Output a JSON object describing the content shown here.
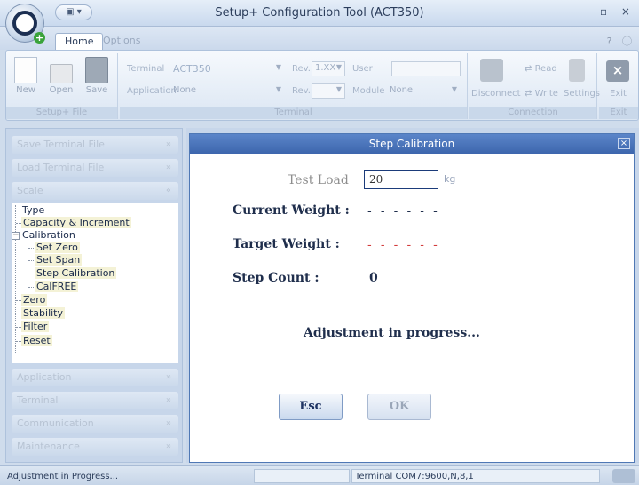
{
  "window": {
    "title": "Setup+ Configuration Tool (ACT350)",
    "qat_label": "▾",
    "controls": "– ▫ ×"
  },
  "tabs": [
    {
      "label": "Home"
    },
    {
      "label": "Options"
    }
  ],
  "help_icons": "? ⓘ",
  "ribbon": {
    "file_group": {
      "label": "Setup+ File",
      "new": "New",
      "open": "Open",
      "save": "Save"
    },
    "terminal_group": {
      "label": "Terminal",
      "terminal_label": "Terminal",
      "terminal_value": "ACT350",
      "rev_label": "Rev.",
      "rev_value": "1.XX",
      "user_label": "User",
      "user_value": "",
      "application_label": "Application",
      "application_value": "None",
      "rev2_label": "Rev.",
      "rev2_value": "",
      "module_label": "Module",
      "module_value": "None"
    },
    "connection_group": {
      "label": "Connection",
      "disconnect": "Disconnect",
      "read": "Read",
      "write": "Write",
      "settings": "Settings"
    },
    "exit_group": {
      "label": "Exit",
      "exit": "Exit"
    }
  },
  "nav": {
    "save_terminal_file": "Save Terminal File",
    "load_terminal_file": "Load Terminal File",
    "scale": "Scale",
    "tree": {
      "type": "Type",
      "capacity": "Capacity & Increment",
      "calibration": "Calibration",
      "set_zero": "Set Zero",
      "set_span": "Set Span",
      "step_calibration": "Step Calibration",
      "calfree": "CalFREE",
      "zero": "Zero",
      "stability": "Stability",
      "filter": "Filter",
      "reset": "Reset"
    },
    "application": "Application",
    "terminal": "Terminal",
    "communication": "Communication",
    "maintenance": "Maintenance"
  },
  "dialog": {
    "title": "Step Calibration",
    "test_load_label": "Test Load",
    "test_load_value": "20",
    "test_load_unit": "kg",
    "current_weight_label": "Current Weight :",
    "current_weight_value": "- - - - - -",
    "target_weight_label": "Target Weight :",
    "target_weight_value": "- - - - - -",
    "step_count_label": "Step Count :",
    "step_count_value": "0",
    "progress_message": "Adjustment in progress...",
    "esc_label": "Esc",
    "ok_label": "OK"
  },
  "status": {
    "message": "Adjustment in Progress...",
    "connection": "Terminal   COM7:9600,N,8,1"
  },
  "colors": {
    "accent": "#3d66ad",
    "target_dashes": "#d23c3c",
    "current_dashes": "#1f2e4c"
  }
}
